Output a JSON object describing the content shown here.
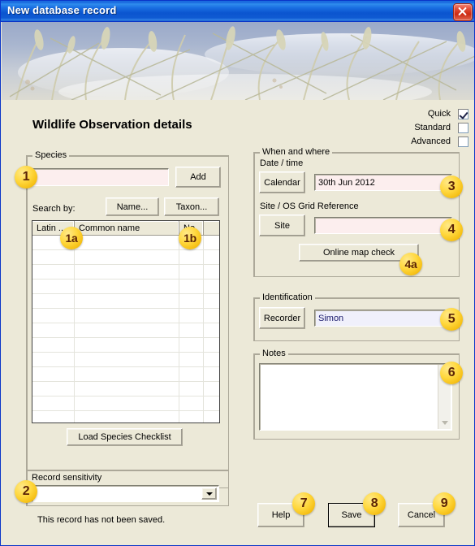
{
  "window": {
    "title": "New database record",
    "close_icon": "close-icon"
  },
  "banner": {
    "alt": "grass-seed-heads-against-sky-banner"
  },
  "page": {
    "title": "Wildlife Observation details",
    "status": "This record has not been saved."
  },
  "view_modes": [
    {
      "label": "Quick",
      "checked": true
    },
    {
      "label": "Standard",
      "checked": false
    },
    {
      "label": "Advanced",
      "checked": false
    }
  ],
  "species": {
    "legend": "Species",
    "input_value": "",
    "add_label": "Add",
    "search_by_label": "Search by:",
    "name_button": "Name...",
    "taxon_button": "Taxon...",
    "grid": {
      "columns": [
        "Latin ...",
        "Common name",
        "No.",
        ""
      ],
      "rows": []
    },
    "load_checklist_label": "Load Species Checklist"
  },
  "sensitivity": {
    "legend": "",
    "label": "Record sensitivity",
    "value": ""
  },
  "when_where": {
    "legend": "When and where",
    "date_label": "Date / time",
    "calendar_button": "Calendar",
    "date_value": "30th Jun 2012",
    "site_label": "Site / OS Grid Reference",
    "site_button": "Site",
    "site_value": "",
    "map_check_button": "Online map check"
  },
  "identification": {
    "legend": "Identification",
    "recorder_button": "Recorder",
    "recorder_value": "Simon"
  },
  "notes": {
    "legend": "Notes",
    "value": "",
    "scroll_up_icon": "scroll-up-arrow-icon",
    "scroll_down_icon": "scroll-down-arrow-icon"
  },
  "actions": {
    "help": "Help",
    "save": "Save",
    "cancel": "Cancel"
  },
  "callouts": [
    {
      "id": "c1",
      "text": "1"
    },
    {
      "id": "c1a",
      "text": "1a"
    },
    {
      "id": "c1b",
      "text": "1b"
    },
    {
      "id": "c2",
      "text": "2"
    },
    {
      "id": "c3",
      "text": "3"
    },
    {
      "id": "c4",
      "text": "4"
    },
    {
      "id": "c4a",
      "text": "4a"
    },
    {
      "id": "c5",
      "text": "5"
    },
    {
      "id": "c6",
      "text": "6"
    },
    {
      "id": "c7",
      "text": "7"
    },
    {
      "id": "c8",
      "text": "8"
    },
    {
      "id": "c9",
      "text": "9"
    }
  ],
  "colors": {
    "titlebar_blue": "#0A35C8",
    "dialog_face": "#ECE9D8",
    "required_field_pink": "#FCEEEE",
    "recorder_field_lilac": "#F0F0FB",
    "callout_yellow": "#FFD83F",
    "callout_text": "#5B2406",
    "close_red": "#CC2A12"
  }
}
